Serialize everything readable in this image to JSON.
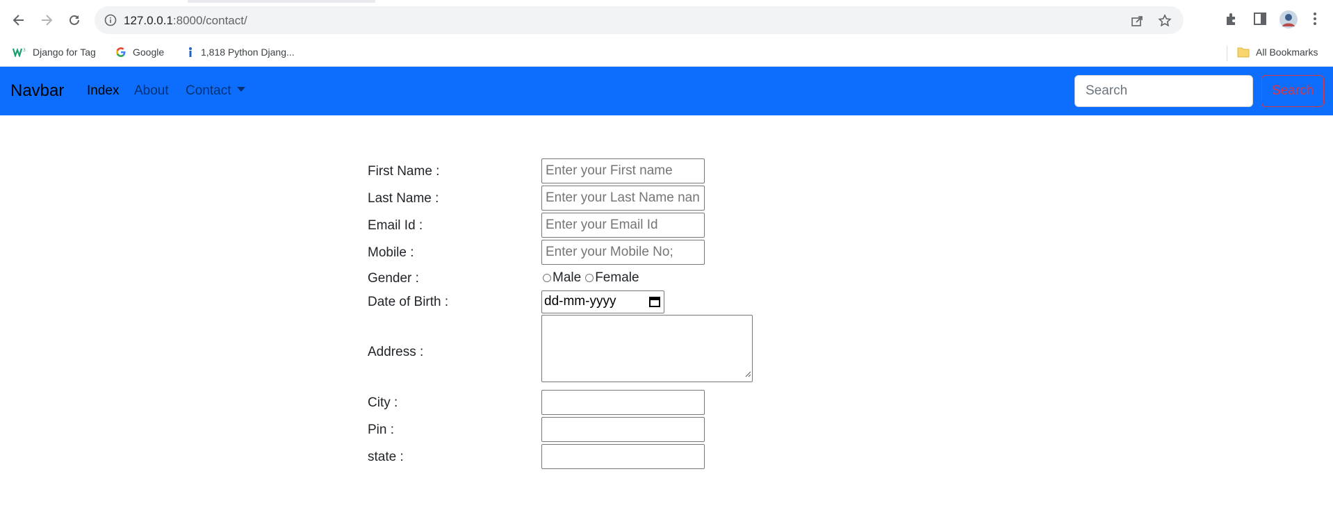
{
  "browser": {
    "url_host": "127.0.0.1",
    "url_path": ":8000/contact/",
    "bookmarks": [
      {
        "label": "Django for Tag",
        "icon": "w-logo-icon"
      },
      {
        "label": "Google",
        "icon": "google-icon"
      },
      {
        "label": "1,818 Python Djang...",
        "icon": "info-i-icon"
      }
    ],
    "all_bookmarks_label": "All Bookmarks"
  },
  "navbar": {
    "brand": "Navbar",
    "links": [
      "Index",
      "About",
      "Contact"
    ],
    "active_link": "Index",
    "search_placeholder": "Search",
    "search_button": "Search",
    "colors": {
      "background": "#0d6efd",
      "search_button": "#dc3545"
    }
  },
  "form": {
    "first_name": {
      "label": "First Name :",
      "placeholder": "Enter your First name"
    },
    "last_name": {
      "label": "Last Name :",
      "placeholder": "Enter your Last Name nan"
    },
    "email": {
      "label": "Email Id :",
      "placeholder": "Enter your Email Id"
    },
    "mobile": {
      "label": "Mobile :",
      "placeholder": "Enter your Mobile No;"
    },
    "gender": {
      "label": "Gender :",
      "options": [
        "Male",
        "Female"
      ]
    },
    "dob": {
      "label": "Date of Birth :",
      "placeholder": "dd-mm-yyyy"
    },
    "address": {
      "label": "Address :"
    },
    "city": {
      "label": "City :"
    },
    "pin": {
      "label": "Pin :"
    },
    "state": {
      "label": "state :"
    }
  }
}
